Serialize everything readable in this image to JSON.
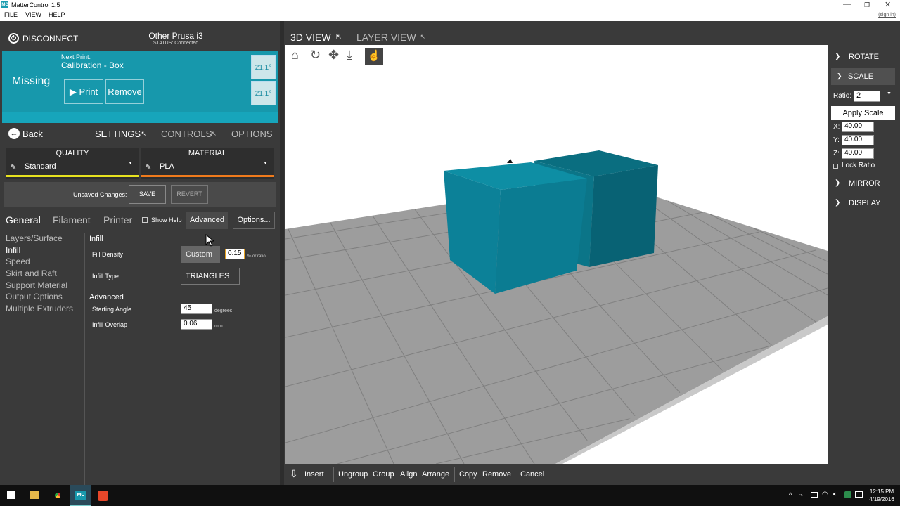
{
  "window": {
    "title": "MatterControl 1.5",
    "logo": "MC"
  },
  "menu": {
    "items": [
      "FILE",
      "VIEW",
      "HELP"
    ],
    "signin": "(sign in)"
  },
  "printer": {
    "disconnect_label": "DISCONNECT",
    "name": "Other Prusa i3",
    "status": "STATUS: Connected"
  },
  "print_panel": {
    "missing": "Missing",
    "next_label": "Next Print:",
    "next_name": "Calibration - Box",
    "print_btn": "Print",
    "remove_btn": "Remove",
    "temp1": "21.1°",
    "temp2": "21.1°"
  },
  "nav": {
    "back": "Back",
    "tabs": [
      "SETTINGS",
      "CONTROLS",
      "OPTIONS"
    ]
  },
  "presets": {
    "quality_label": "QUALITY",
    "quality_value": "Standard",
    "material_label": "MATERIAL",
    "material_value": "PLA",
    "quality_color": "#e7e21f",
    "material_color": "#ef7a1c"
  },
  "changes": {
    "label": "Unsaved Changes:",
    "save": "SAVE",
    "revert": "REVERT"
  },
  "settings_tabs": {
    "general": "General",
    "filament": "Filament",
    "printer": "Printer",
    "show_help": "Show Help",
    "advanced": "Advanced",
    "options": "Options..."
  },
  "categories": [
    "Layers/Surface",
    "Infill",
    "Speed",
    "Skirt and Raft",
    "Support Material",
    "Output Options",
    "Multiple Extruders"
  ],
  "infill": {
    "section": "Infill",
    "fill_density_label": "Fill Density",
    "fill_density_mode": "Custom",
    "fill_density_value": "0.15",
    "fill_density_unit": "% or ratio",
    "infill_type_label": "Infill Type",
    "infill_type_value": "TRIANGLES",
    "advanced_section": "Advanced",
    "starting_angle_label": "Starting Angle",
    "starting_angle_value": "45",
    "starting_angle_unit": "degrees",
    "infill_overlap_label": "Infill Overlap",
    "infill_overlap_value": "0.06",
    "infill_overlap_unit": "mm"
  },
  "view_tabs": {
    "view3d": "3D VIEW",
    "layer": "LAYER VIEW"
  },
  "view_tools": [
    "home-icon",
    "rotate-icon",
    "move-icon",
    "drop-icon",
    "select-hand-icon"
  ],
  "bottom_toolbar": {
    "insert": "Insert",
    "ungroup": "Ungroup",
    "group": "Group",
    "align": "Align",
    "arrange": "Arrange",
    "copy": "Copy",
    "remove": "Remove",
    "cancel": "Cancel"
  },
  "right_panel": {
    "rotate": "ROTATE",
    "scale": "SCALE",
    "ratio_label": "Ratio:",
    "ratio_value": "2",
    "apply_scale": "Apply Scale",
    "x_label": "X:",
    "x_value": "40.00",
    "y_label": "Y:",
    "y_value": "40.00",
    "z_label": "Z:",
    "z_value": "40.00",
    "lock_ratio": "Lock Ratio",
    "mirror": "MIRROR",
    "display": "DISPLAY"
  },
  "taskbar": {
    "time": "12:15 PM",
    "date": "4/19/2016"
  },
  "colors": {
    "accent": "#1798ac",
    "model": "#0d8aa0",
    "bed": "#9a9a9a"
  }
}
